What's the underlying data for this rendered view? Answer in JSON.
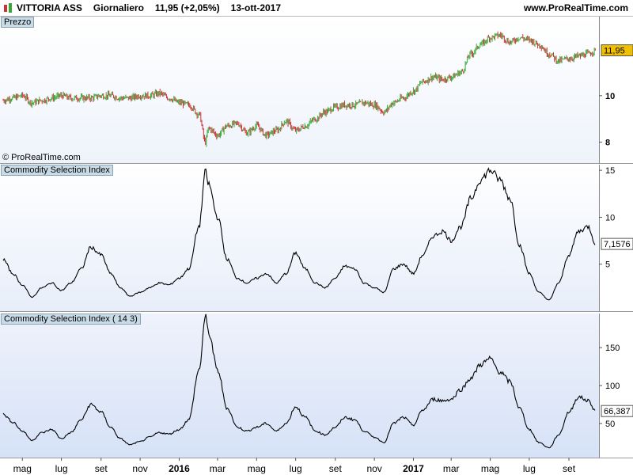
{
  "header": {
    "symbol": "VITTORIA ASS",
    "period": "Giornaliero",
    "quote": "11,95 (+2,05%)",
    "date": "13-ott-2017",
    "website": "www.ProRealTime.com"
  },
  "copyright": "© ProRealTime.com",
  "colors": {
    "up": "#33aa33",
    "down": "#cc3333",
    "badge_price": "#f0c000"
  },
  "chart_data": [
    {
      "type": "candlestick",
      "title": "Prezzo",
      "y_ticks": [
        "8",
        "10"
      ],
      "y_tick_values": [
        8,
        10
      ],
      "ylim": [
        7.1,
        13.4
      ],
      "last_value": 11.95,
      "last_label": "11,95",
      "x": [
        "2015-04-01",
        "2015-04-16",
        "2015-05-01",
        "2015-05-16",
        "2015-06-01",
        "2015-06-16",
        "2015-07-01",
        "2015-07-16",
        "2015-08-01",
        "2015-08-16",
        "2015-09-01",
        "2015-09-16",
        "2015-10-01",
        "2015-10-16",
        "2015-11-01",
        "2015-11-16",
        "2015-12-01",
        "2015-12-16",
        "2016-01-01",
        "2016-01-16",
        "2016-02-01",
        "2016-02-11",
        "2016-02-16",
        "2016-03-01",
        "2016-03-16",
        "2016-04-01",
        "2016-04-16",
        "2016-05-01",
        "2016-05-16",
        "2016-06-01",
        "2016-06-16",
        "2016-07-01",
        "2016-07-16",
        "2016-08-01",
        "2016-08-16",
        "2016-09-01",
        "2016-09-16",
        "2016-10-01",
        "2016-10-16",
        "2016-11-01",
        "2016-11-16",
        "2016-12-01",
        "2016-12-16",
        "2017-01-01",
        "2017-01-16",
        "2017-02-01",
        "2017-02-16",
        "2017-03-01",
        "2017-03-16",
        "2017-04-01",
        "2017-04-16",
        "2017-05-01",
        "2017-05-16",
        "2017-06-01",
        "2017-06-16",
        "2017-07-01",
        "2017-07-16",
        "2017-08-01",
        "2017-08-16",
        "2017-09-01",
        "2017-09-16",
        "2017-10-01",
        "2017-10-13"
      ],
      "close": [
        9.8,
        9.9,
        10.0,
        9.7,
        9.8,
        9.9,
        10.0,
        9.9,
        9.9,
        9.9,
        10.0,
        10.0,
        9.9,
        9.9,
        10.0,
        10.0,
        10.1,
        9.9,
        9.7,
        9.6,
        9.2,
        8.0,
        8.6,
        8.3,
        8.7,
        8.8,
        8.4,
        8.7,
        8.3,
        8.5,
        8.9,
        8.5,
        8.7,
        9.0,
        9.3,
        9.5,
        9.6,
        9.6,
        9.7,
        9.6,
        9.3,
        9.7,
        9.9,
        10.2,
        10.6,
        10.8,
        10.7,
        10.8,
        11.0,
        11.8,
        12.2,
        12.5,
        12.6,
        12.3,
        12.5,
        12.4,
        12.2,
        11.8,
        11.5,
        11.6,
        11.7,
        11.8,
        11.95
      ]
    },
    {
      "type": "line",
      "title": "Commodity Selection Index",
      "y_ticks": [
        "5",
        "10",
        "15"
      ],
      "y_tick_values": [
        5,
        10,
        15
      ],
      "ylim": [
        0,
        15.6
      ],
      "last_value": 7.1576,
      "last_label": "7,1576",
      "x": [
        "2015-04-01",
        "2015-04-16",
        "2015-05-01",
        "2015-05-16",
        "2015-06-01",
        "2015-06-16",
        "2015-07-01",
        "2015-07-16",
        "2015-08-01",
        "2015-08-16",
        "2015-09-01",
        "2015-09-16",
        "2015-10-01",
        "2015-10-16",
        "2015-11-01",
        "2015-11-16",
        "2015-12-01",
        "2015-12-16",
        "2016-01-01",
        "2016-01-16",
        "2016-02-01",
        "2016-02-11",
        "2016-02-16",
        "2016-03-01",
        "2016-03-16",
        "2016-04-01",
        "2016-04-16",
        "2016-05-01",
        "2016-05-16",
        "2016-06-01",
        "2016-06-16",
        "2016-07-01",
        "2016-07-16",
        "2016-08-01",
        "2016-08-16",
        "2016-09-01",
        "2016-09-16",
        "2016-10-01",
        "2016-10-16",
        "2016-11-01",
        "2016-11-16",
        "2016-12-01",
        "2016-12-16",
        "2017-01-01",
        "2017-01-16",
        "2017-02-01",
        "2017-02-16",
        "2017-03-01",
        "2017-03-16",
        "2017-04-01",
        "2017-04-16",
        "2017-05-01",
        "2017-05-16",
        "2017-06-01",
        "2017-06-16",
        "2017-07-01",
        "2017-07-16",
        "2017-08-01",
        "2017-08-16",
        "2017-09-01",
        "2017-09-16",
        "2017-10-01",
        "2017-10-13"
      ],
      "values": [
        5.5,
        4.0,
        2.8,
        1.5,
        2.5,
        3.0,
        2.2,
        3.0,
        4.5,
        6.8,
        6.0,
        4.0,
        2.5,
        1.6,
        2.0,
        2.5,
        3.0,
        2.8,
        3.5,
        4.5,
        9.0,
        14.8,
        13.5,
        10.0,
        5.5,
        3.5,
        3.0,
        3.5,
        4.0,
        3.0,
        4.0,
        6.2,
        4.5,
        3.0,
        2.5,
        3.5,
        4.8,
        4.5,
        3.0,
        2.5,
        2.0,
        4.5,
        5.0,
        4.0,
        6.0,
        8.0,
        8.5,
        7.5,
        9.0,
        12.0,
        14.0,
        15.0,
        14.0,
        12.0,
        7.0,
        4.0,
        2.0,
        1.2,
        3.0,
        6.0,
        8.5,
        9.0,
        7.1576
      ]
    },
    {
      "type": "line",
      "title": "Commodity Selection Index ( 14 3)",
      "y_ticks": [
        "50",
        "100",
        "150"
      ],
      "y_tick_values": [
        50,
        100,
        150
      ],
      "ylim": [
        5,
        195
      ],
      "last_value": 66.387,
      "last_label": "66,387",
      "x": [
        "2015-04-01",
        "2015-04-16",
        "2015-05-01",
        "2015-05-16",
        "2015-06-01",
        "2015-06-16",
        "2015-07-01",
        "2015-07-16",
        "2015-08-01",
        "2015-08-16",
        "2015-09-01",
        "2015-09-16",
        "2015-10-01",
        "2015-10-16",
        "2015-11-01",
        "2015-11-16",
        "2015-12-01",
        "2015-12-16",
        "2016-01-01",
        "2016-01-16",
        "2016-02-01",
        "2016-02-11",
        "2016-02-16",
        "2016-03-01",
        "2016-03-16",
        "2016-04-01",
        "2016-04-16",
        "2016-05-01",
        "2016-05-16",
        "2016-06-01",
        "2016-06-16",
        "2016-07-01",
        "2016-07-16",
        "2016-08-01",
        "2016-08-16",
        "2016-09-01",
        "2016-09-16",
        "2016-10-01",
        "2016-10-16",
        "2016-11-01",
        "2016-11-16",
        "2016-12-01",
        "2016-12-16",
        "2017-01-01",
        "2017-01-16",
        "2017-02-01",
        "2017-02-16",
        "2017-03-01",
        "2017-03-16",
        "2017-04-01",
        "2017-04-16",
        "2017-05-01",
        "2017-05-16",
        "2017-06-01",
        "2017-06-16",
        "2017-07-01",
        "2017-07-16",
        "2017-08-01",
        "2017-08-16",
        "2017-09-01",
        "2017-09-16",
        "2017-10-01",
        "2017-10-13"
      ],
      "values": [
        62,
        52,
        40,
        28,
        38,
        42,
        30,
        38,
        55,
        75,
        65,
        45,
        30,
        22,
        26,
        32,
        38,
        36,
        42,
        55,
        120,
        190,
        170,
        120,
        70,
        45,
        40,
        45,
        50,
        40,
        50,
        72,
        58,
        40,
        35,
        45,
        58,
        55,
        40,
        32,
        25,
        50,
        58,
        48,
        68,
        82,
        80,
        82,
        95,
        110,
        128,
        135,
        118,
        105,
        70,
        42,
        25,
        18,
        35,
        65,
        85,
        80,
        66.387
      ]
    }
  ],
  "x_axis": {
    "labels": [
      {
        "text": "mag",
        "date": "2015-05-01",
        "bold": false
      },
      {
        "text": "lug",
        "date": "2015-07-01",
        "bold": false
      },
      {
        "text": "set",
        "date": "2015-09-01",
        "bold": false
      },
      {
        "text": "nov",
        "date": "2015-11-01",
        "bold": false
      },
      {
        "text": "2016",
        "date": "2016-01-01",
        "bold": true
      },
      {
        "text": "mar",
        "date": "2016-03-01",
        "bold": false
      },
      {
        "text": "mag",
        "date": "2016-05-01",
        "bold": false
      },
      {
        "text": "lug",
        "date": "2016-07-01",
        "bold": false
      },
      {
        "text": "set",
        "date": "2016-09-01",
        "bold": false
      },
      {
        "text": "nov",
        "date": "2016-11-01",
        "bold": false
      },
      {
        "text": "2017",
        "date": "2017-01-01",
        "bold": true
      },
      {
        "text": "mar",
        "date": "2017-03-01",
        "bold": false
      },
      {
        "text": "mag",
        "date": "2017-05-01",
        "bold": false
      },
      {
        "text": "lug",
        "date": "2017-07-01",
        "bold": false
      },
      {
        "text": "set",
        "date": "2017-09-01",
        "bold": false
      }
    ],
    "range": [
      "2015-04-01",
      "2017-10-13"
    ]
  }
}
